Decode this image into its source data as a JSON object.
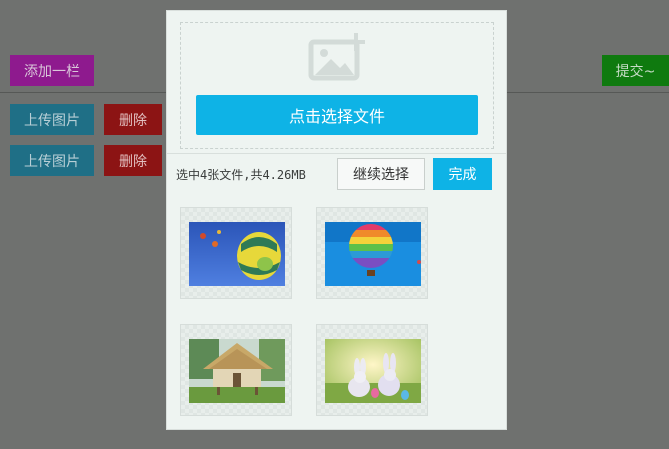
{
  "page": {
    "add_row_label": "添加一栏",
    "submit_label": "提交~",
    "rows": [
      {
        "upload_label": "上传图片",
        "delete_label": "删除"
      },
      {
        "upload_label": "上传图片",
        "delete_label": "删除"
      }
    ]
  },
  "modal": {
    "pick_file_label": "点击选择文件",
    "summary_text": "选中4张文件,共4.26MB",
    "continue_label": "继续选择",
    "done_label": "完成",
    "thumbnails": [
      {
        "icon": "hot-air-balloon-image"
      },
      {
        "icon": "rainbow-balloon-image"
      },
      {
        "icon": "thatched-hut-image"
      },
      {
        "icon": "easter-bunnies-image"
      }
    ]
  },
  "colors": {
    "overlay": "#6f716f",
    "purple": "#8e1a8e",
    "green": "#0f7a0f",
    "teal": "#1f6f86",
    "red": "#8c1414",
    "accent": "#0eb3e6"
  }
}
